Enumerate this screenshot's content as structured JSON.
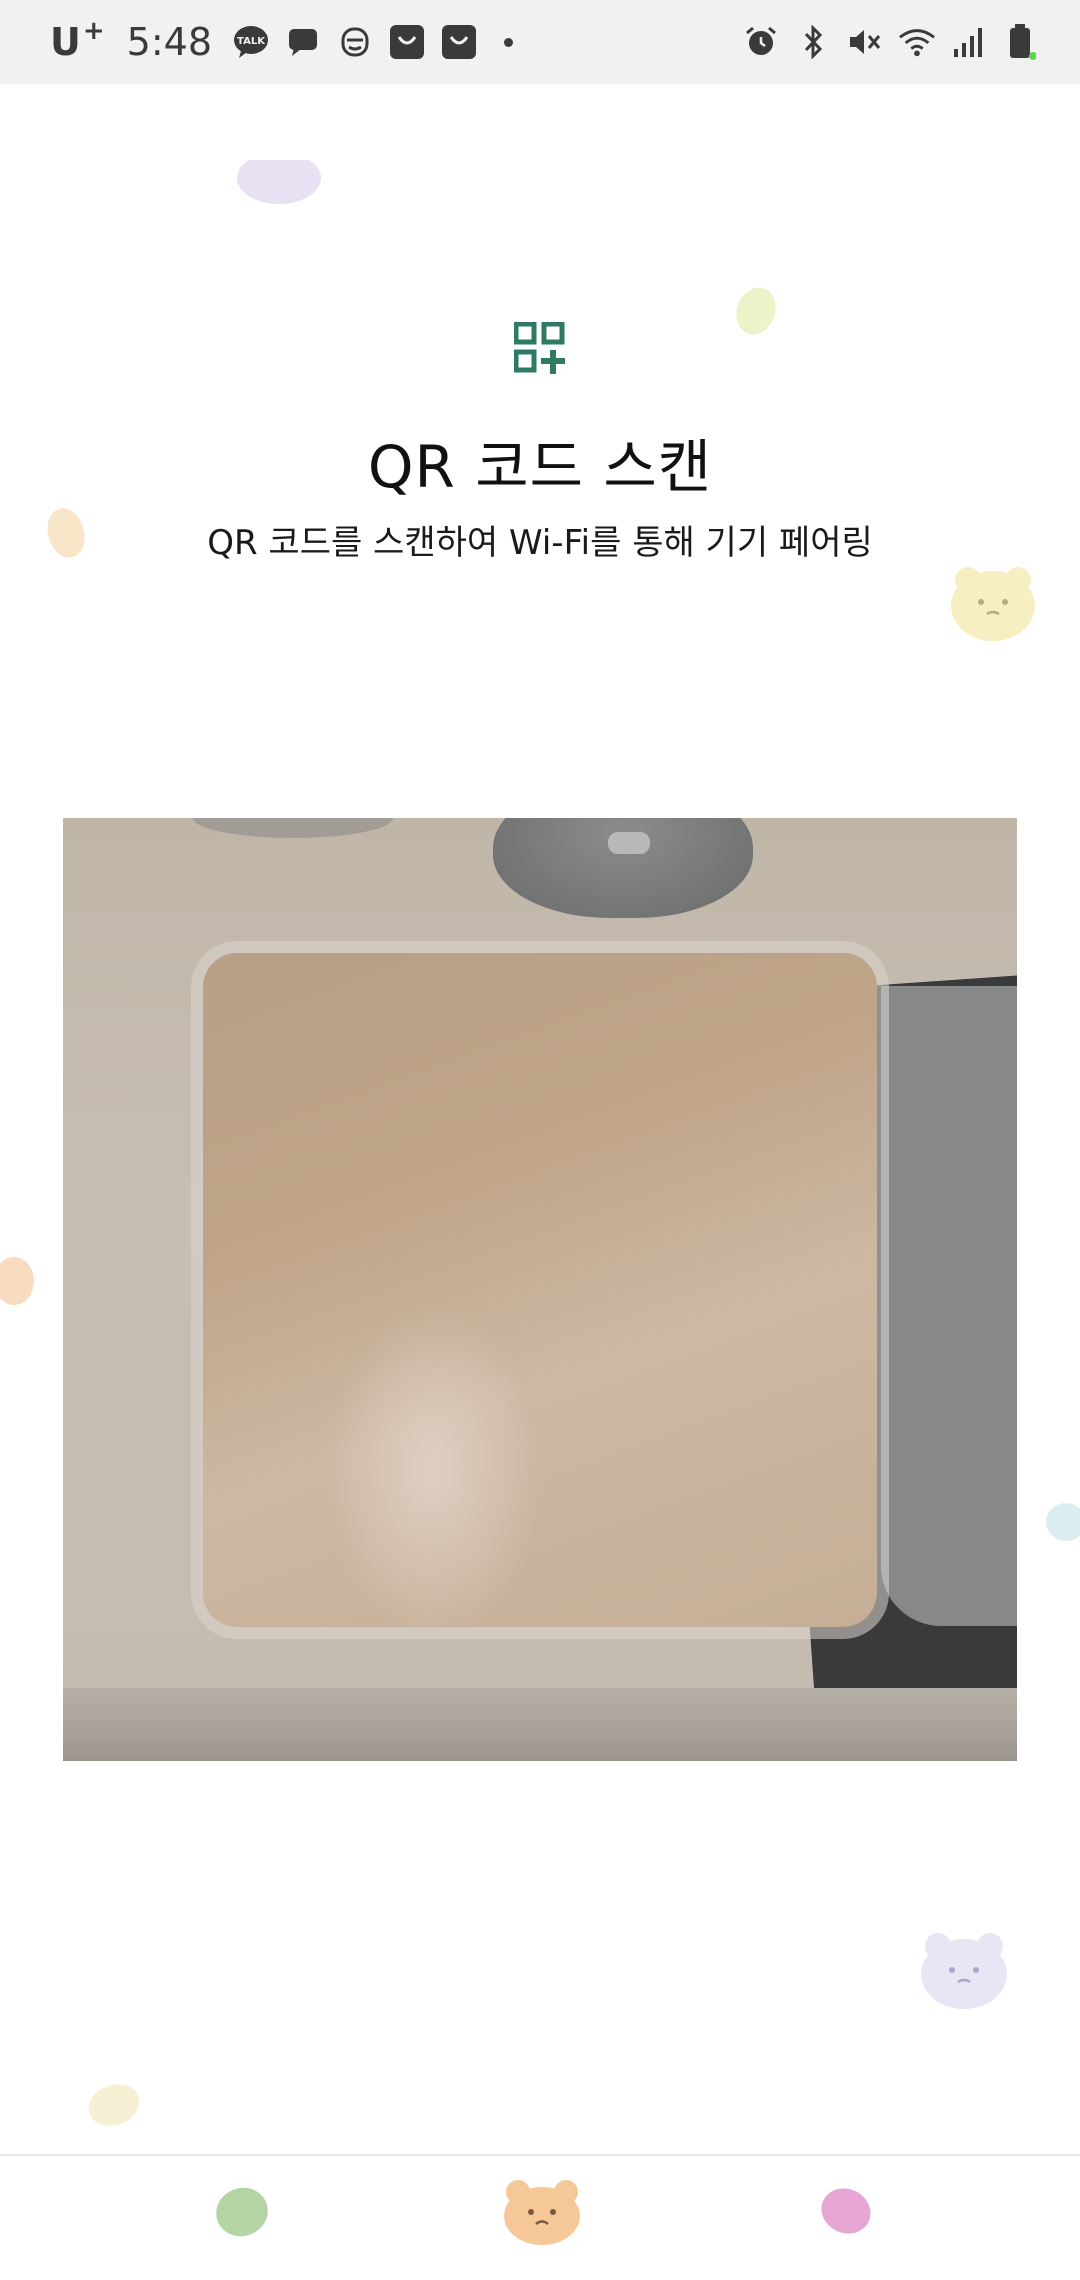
{
  "status_bar": {
    "carrier": "U",
    "carrier_sup": "+",
    "time": "5:48",
    "left_icons": [
      "kakaotalk-icon",
      "message-icon",
      "bot-face-icon",
      "shopping-bag-icon",
      "shopping-bag-icon",
      "more-dot-icon"
    ],
    "right_icons": [
      "alarm-icon",
      "bluetooth-icon",
      "mute-icon",
      "wifi-icon",
      "cell-signal-icon",
      "battery-icon"
    ],
    "kakao_label": "TALK"
  },
  "header": {
    "icon": "qr-code-icon",
    "title": "QR 코드 스캔",
    "subtitle": "QR 코드를 스캔하여 Wi-Fi를 통해 기기 페어링"
  },
  "camera": {
    "state": "scanning"
  },
  "bottom_nav": {
    "items": [
      {
        "icon": "green-bean-icon"
      },
      {
        "icon": "bear-face-icon"
      },
      {
        "icon": "pink-bean-icon"
      }
    ]
  },
  "colors": {
    "accent": "#2f7a64",
    "status_bar_bg": "#f1f1f1",
    "bean_green": "#b5d4a6",
    "bean_pink": "#e6a6d4",
    "bear_orange": "#f6c898"
  }
}
